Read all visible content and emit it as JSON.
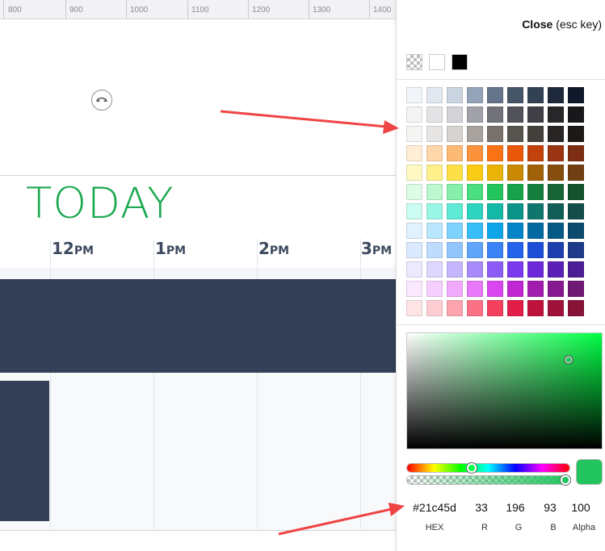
{
  "ruler": {
    "labels": [
      "800",
      "900",
      "1000",
      "1100",
      "1200",
      "1300",
      "1400"
    ]
  },
  "canvas": {
    "today_text": "TODAY",
    "hours": [
      {
        "num": "12",
        "suffix": "PM"
      },
      {
        "num": "1",
        "suffix": "PM"
      },
      {
        "num": "2",
        "suffix": "PM"
      },
      {
        "num": "3",
        "suffix": "PM"
      }
    ],
    "colors": {
      "today_green": "#19a84e",
      "dark_band": "#344057"
    }
  },
  "panel": {
    "close_label": "Close",
    "close_hint": "(esc key)",
    "quick_swatches": [
      {
        "name": "transparent-swatch",
        "color": "transparent"
      },
      {
        "name": "white-swatch",
        "color": "#ffffff"
      },
      {
        "name": "black-swatch",
        "color": "#000000"
      }
    ],
    "palette": [
      [
        "#f1f5f9",
        "#e2e8f0",
        "#cbd5e1",
        "#94a3b8",
        "#64748b",
        "#475569",
        "#334155",
        "#1e293b",
        "#0f172a"
      ],
      [
        "#f4f4f5",
        "#e4e4e7",
        "#d4d4d8",
        "#a1a1aa",
        "#71717a",
        "#52525b",
        "#3f3f46",
        "#27272a",
        "#18181b"
      ],
      [
        "#f5f5f4",
        "#e7e5e4",
        "#d6d3d1",
        "#a8a29e",
        "#78716c",
        "#57534e",
        "#44403c",
        "#292524",
        "#1c1917"
      ],
      [
        "#ffedd5",
        "#fed7aa",
        "#fdba74",
        "#fb923c",
        "#f97316",
        "#ea580c",
        "#c2410c",
        "#9a3412",
        "#7c2d12"
      ],
      [
        "#fef9c3",
        "#fef08a",
        "#fde047",
        "#facc15",
        "#eab308",
        "#ca8a04",
        "#a16207",
        "#854d0e",
        "#713f12"
      ],
      [
        "#dcfce7",
        "#bbf7d0",
        "#86efac",
        "#4ade80",
        "#22c55e",
        "#16a34a",
        "#15803d",
        "#166534",
        "#14532d"
      ],
      [
        "#ccfbf1",
        "#99f6e4",
        "#5eead4",
        "#2dd4bf",
        "#14b8a6",
        "#0d9488",
        "#0f766e",
        "#115e59",
        "#134e4a"
      ],
      [
        "#e0f2fe",
        "#bae6fd",
        "#7dd3fc",
        "#38bdf8",
        "#0ea5e9",
        "#0284c7",
        "#0369a1",
        "#075985",
        "#0c4a6e"
      ],
      [
        "#dbeafe",
        "#bfdbfe",
        "#93c5fd",
        "#60a5fa",
        "#3b82f6",
        "#2563eb",
        "#1d4ed8",
        "#1e40af",
        "#1e3a8a"
      ],
      [
        "#ede9fe",
        "#ddd6fe",
        "#c4b5fd",
        "#a78bfa",
        "#8b5cf6",
        "#7c3aed",
        "#6d28d9",
        "#5b21b6",
        "#4c1d95"
      ],
      [
        "#fae8ff",
        "#f5d0fe",
        "#f0abfc",
        "#e879f9",
        "#d946ef",
        "#c026d3",
        "#a21caf",
        "#86198f",
        "#701a75"
      ],
      [
        "#ffe4e6",
        "#fecdd3",
        "#fda4af",
        "#fb7185",
        "#f43f5e",
        "#e11d48",
        "#be123c",
        "#9f1239",
        "#881337"
      ]
    ],
    "picker": {
      "hue_color": "#00ff44",
      "selected_color": "#21c45d",
      "saturation_value": {
        "s": 0.83,
        "v": 0.77
      },
      "hue_fraction": 0.4,
      "alpha_fraction": 1.0
    },
    "values": {
      "hex": "#21c45d",
      "r": "33",
      "g": "196",
      "b": "93",
      "alpha": "100",
      "hex_label": "HEX",
      "r_label": "R",
      "g_label": "G",
      "b_label": "B",
      "alpha_label": "Alpha"
    },
    "annotation_color": "#ef4444"
  }
}
